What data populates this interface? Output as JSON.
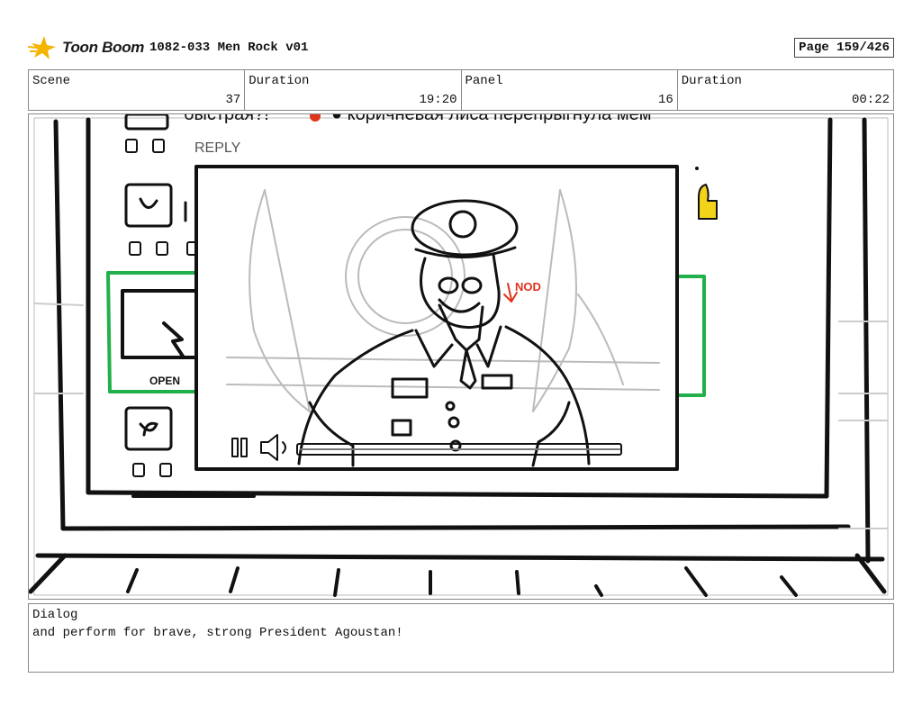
{
  "header": {
    "logo_text": "Toon Boom",
    "project_title": "1082-033 Men Rock v01",
    "page_label": "Page 159/426"
  },
  "info": {
    "scene_label": "Scene",
    "scene_value": "37",
    "duration_label": "Duration",
    "duration_value": "19:20",
    "panel_label": "Panel",
    "panel_value": "16",
    "panel_duration_label": "Duration",
    "panel_duration_value": "00:22"
  },
  "drawing": {
    "reply_text": "REPLY",
    "open_text": "OPEN",
    "annotation_text": "NOD",
    "accent_green": "#22b04a",
    "accent_red": "#e0331c",
    "accent_yellow": "#f2d31a"
  },
  "dialog": {
    "label": "Dialog",
    "text": "and perform for brave, strong President Agoustan!"
  }
}
